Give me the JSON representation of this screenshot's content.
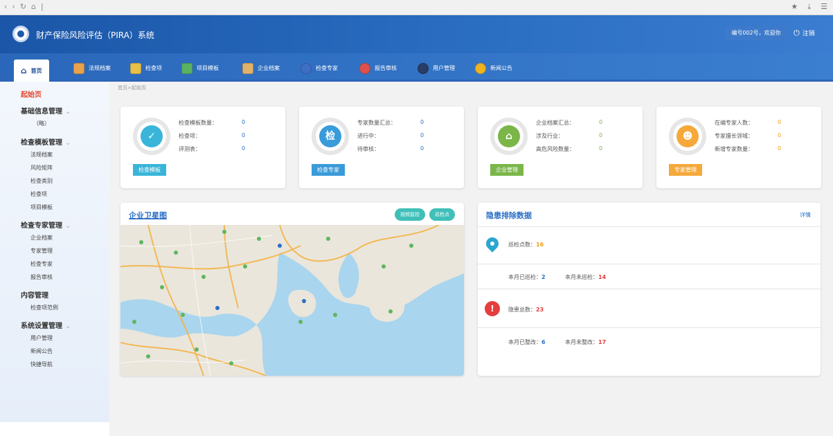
{
  "header": {
    "title": "财产保险风险评估（PIRA）系统",
    "user": "编号002号，欢迎你",
    "logout": "注销"
  },
  "tabs": [
    {
      "label": "首页",
      "color": "#1d4c96"
    },
    {
      "label": "法规档案",
      "color": "#e8a24b"
    },
    {
      "label": "检查项",
      "color": "#e7c04a"
    },
    {
      "label": "项目模板",
      "color": "#5ab162"
    },
    {
      "label": "企业档案",
      "color": "#e0b26a"
    },
    {
      "label": "检查专家",
      "color": "#3e6fc4"
    },
    {
      "label": "报告审核",
      "color": "#e0504b"
    },
    {
      "label": "用户管理",
      "color": "#2a3d66"
    },
    {
      "label": "新闻公告",
      "color": "#f0b320"
    }
  ],
  "sidebar": {
    "start": "起始页",
    "groups": [
      {
        "title": "基础信息管理",
        "items": [
          "（略）"
        ]
      },
      {
        "title": "检查模板管理",
        "items": [
          "法规档案",
          "风险矩阵",
          "检查类别",
          "检查项",
          "项目模板"
        ]
      },
      {
        "title": "检查专家管理",
        "items": [
          "企业档案",
          "专家管理",
          "检查专家",
          "报告审核"
        ]
      },
      {
        "title": "内容管理",
        "items": [
          "检查项范例"
        ]
      },
      {
        "title": "系统设置管理",
        "items": [
          "用户管理",
          "新闻公告",
          "快捷导航"
        ]
      }
    ]
  },
  "breadcrumb": "首页>起始页",
  "cards": [
    {
      "icon": "✓",
      "color": "#3ab5d9",
      "button": "检查模板",
      "stats": [
        {
          "label": "检查模板数量：",
          "value": "0"
        },
        {
          "label": "检查项：",
          "value": "0"
        },
        {
          "label": "评测表：",
          "value": "0"
        }
      ],
      "valcolor": "#2a6fc5"
    },
    {
      "icon": "检",
      "color": "#3a9bd9",
      "button": "检查专家",
      "stats": [
        {
          "label": "专家数量汇总：",
          "value": "0"
        },
        {
          "label": "进行中：",
          "value": "0"
        },
        {
          "label": "待审核：",
          "value": "0"
        }
      ],
      "valcolor": "#2a6fc5"
    },
    {
      "icon": "⌂",
      "color": "#7ab648",
      "button": "企业管理",
      "stats": [
        {
          "label": "企业档案汇总：",
          "value": "0"
        },
        {
          "label": "涉及行业：",
          "value": "0"
        },
        {
          "label": "高危风险数量：",
          "value": "0"
        }
      ],
      "valcolor": "#7ab648"
    },
    {
      "icon": "☻",
      "color": "#f5a93a",
      "button": "专家管理",
      "stats": [
        {
          "label": "在编专家人数：",
          "value": "0"
        },
        {
          "label": "专家擅长领域：",
          "value": "0"
        },
        {
          "label": "新增专家数量：",
          "value": "0"
        }
      ],
      "valcolor": "#f39c12"
    }
  ],
  "map": {
    "title": "企业卫星图",
    "btn1": "视频监控",
    "btn2": "巡检点"
  },
  "hazard": {
    "title": "隐患排除数据",
    "detail": "详情",
    "inspect_label": "巡检点数：",
    "inspect_value": "16",
    "done_label": "本月已巡检：",
    "done_value": "2",
    "notdone_label": "本月未巡检：",
    "notdone_value": "14",
    "total_label": "隐患总数：",
    "total_value": "23",
    "fixed_label": "本月已整改：",
    "fixed_value": "6",
    "unfixed_label": "本月未整改：",
    "unfixed_value": "17"
  }
}
